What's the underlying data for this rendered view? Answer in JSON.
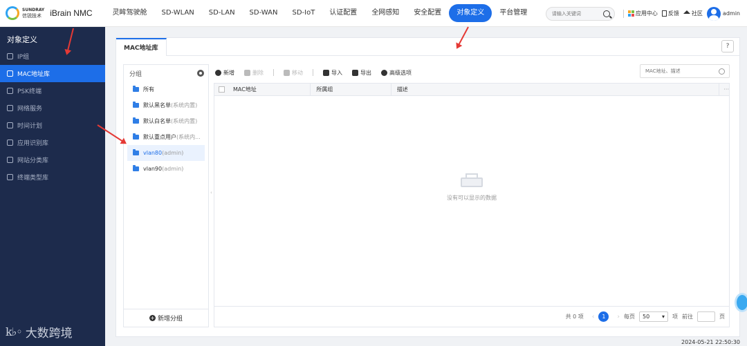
{
  "brand": {
    "en": "SUNDRAY",
    "cn": "信锐技术",
    "product": "iBrain NMC"
  },
  "nav": {
    "items": [
      "灵眸驾驶舱",
      "SD-WLAN",
      "SD-LAN",
      "SD-WAN",
      "SD-IoT",
      "认证配置",
      "全网感知",
      "安全配置",
      "对象定义",
      "平台管理"
    ],
    "active_index": 8
  },
  "topright": {
    "search_placeholder": "请输入关键词",
    "app_center": "应用中心",
    "feedback": "反馈",
    "community": "社区",
    "user": "admin"
  },
  "sidebar": {
    "title": "对象定义",
    "items": [
      "IP组",
      "MAC地址库",
      "PSK终端",
      "网络服务",
      "时间计划",
      "应用识别库",
      "网站分类库",
      "终端类型库"
    ],
    "active_index": 1,
    "footer": {
      "mark": "k♭◦",
      "text": "大数跨境"
    }
  },
  "main": {
    "tab": "MAC地址库",
    "help": "?",
    "groups": {
      "title": "分组",
      "items": [
        {
          "name": "所有",
          "note": ""
        },
        {
          "name": "默认黑名单",
          "note": "(系统内置)"
        },
        {
          "name": "默认白名单",
          "note": "(系统内置)"
        },
        {
          "name": "默认重点用户",
          "note": "(系统内..."
        },
        {
          "name": "vlan80",
          "note": "(admin)"
        },
        {
          "name": "vlan90",
          "note": "(admin)"
        }
      ],
      "selected_index": 4,
      "add_label": "新增分组"
    },
    "toolbar": {
      "add": "新增",
      "delete": "删除",
      "move": "移动",
      "import": "导入",
      "export": "导出",
      "advanced": "高级选项",
      "search_placeholder": "MAC地址、描述"
    },
    "table": {
      "columns": [
        "MAC地址",
        "所属组",
        "描述"
      ],
      "more": "···",
      "empty_text": "没有可以显示的数据"
    },
    "pager": {
      "total": "共 0 项",
      "prev": "‹",
      "page": "1",
      "next": "›",
      "per_page_label": "每页",
      "per_page_value": "50",
      "items_label": "项",
      "goto_label": "前往",
      "page_label": "页"
    }
  },
  "datetime": "2024-05-21 22:50:30",
  "colors": {
    "accent": "#1d6ee8",
    "sidebar": "#1d2b4c",
    "annotation": "#e53935"
  }
}
